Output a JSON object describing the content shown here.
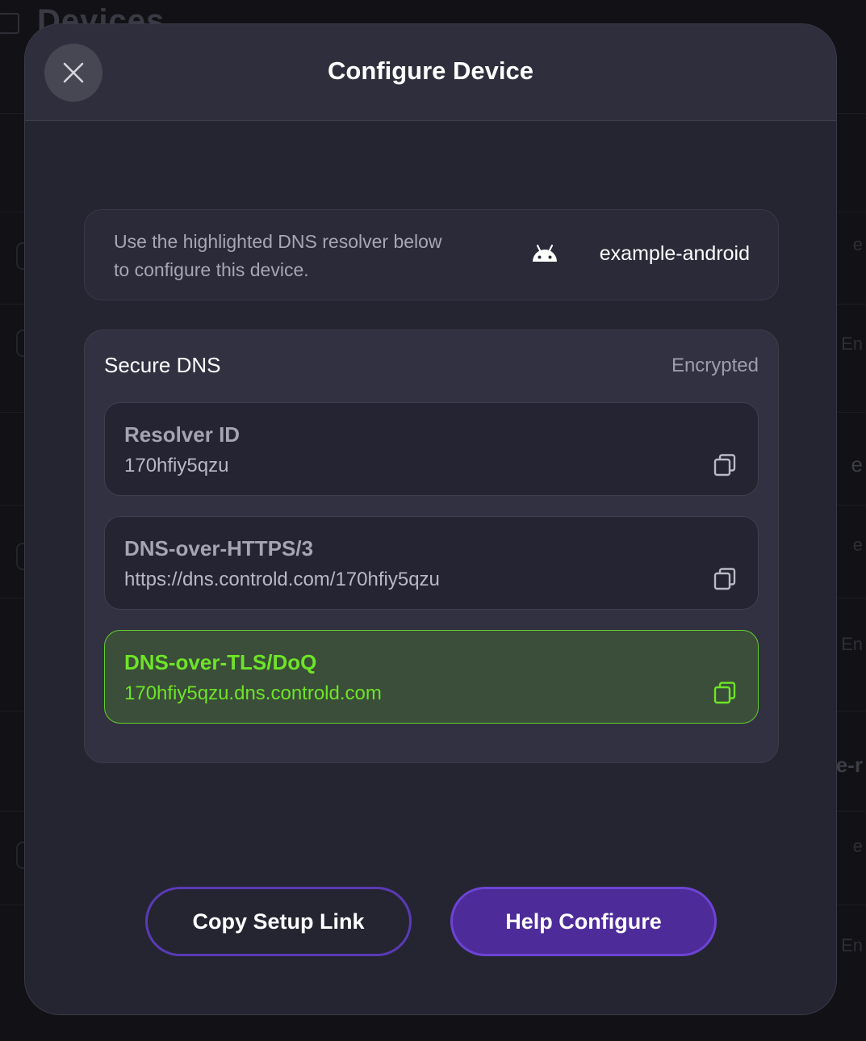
{
  "background": {
    "page_title": "Devices",
    "right_snippets": [
      "e",
      "En",
      "e",
      "e",
      "En",
      "e-r",
      "e",
      "En"
    ]
  },
  "modal": {
    "title": "Configure Device",
    "close_icon": "close-icon",
    "info": {
      "text": "Use the highlighted DNS resolver below to configure this device.",
      "device_icon": "android-icon",
      "device_name": "example-android"
    },
    "secure_dns": {
      "title": "Secure DNS",
      "status": "Encrypted",
      "resolvers": [
        {
          "label": "Resolver ID",
          "value": "170hfiy5qzu",
          "icon": "copy-icon",
          "highlighted": false
        },
        {
          "label": "DNS-over-HTTPS/3",
          "value": "https://dns.controld.com/170hfiy5qzu",
          "icon": "copy-icon",
          "highlighted": false
        },
        {
          "label": "DNS-over-TLS/DoQ",
          "value": "170hfiy5qzu.dns.controld.com",
          "icon": "copy-icon",
          "highlighted": true
        }
      ]
    },
    "buttons": {
      "copy_setup_link": "Copy Setup Link",
      "help_configure": "Help Configure"
    }
  },
  "colors": {
    "modal_bg": "#252532",
    "highlight_green": "#6ee428",
    "primary_purple": "#4d2b99"
  }
}
